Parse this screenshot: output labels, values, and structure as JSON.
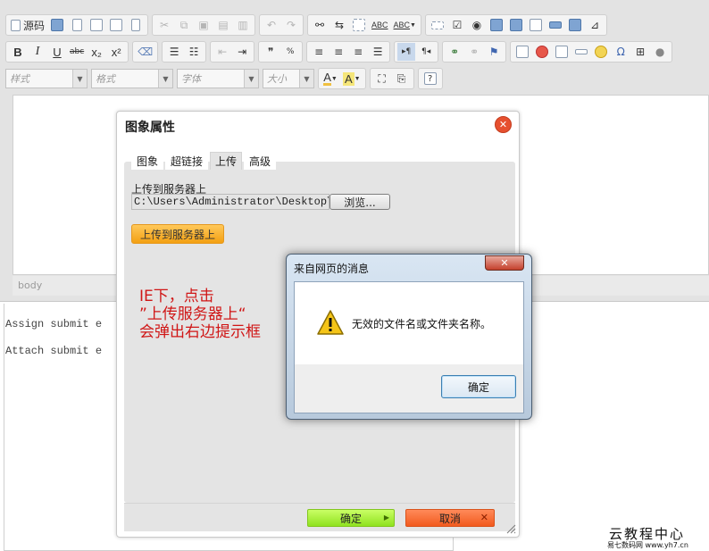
{
  "toolbar": {
    "source_label": "源码",
    "combos": [
      {
        "label": "样式"
      },
      {
        "label": "格式"
      },
      {
        "label": "字体"
      },
      {
        "label": "大小"
      }
    ],
    "subscript": "x₂",
    "superscript": "x²",
    "spellcheck": "ABC",
    "text_color_glyph": "A",
    "bg_color_glyph": "A",
    "help_glyph": "?"
  },
  "editor": {
    "status_path": "body"
  },
  "form": {
    "line1": "Assign submit  e",
    "line2": "Attach submit  e"
  },
  "image_dialog": {
    "title": "图象属性",
    "tabs": [
      {
        "label": "图象",
        "active": false
      },
      {
        "label": "超链接",
        "active": false
      },
      {
        "label": "上传",
        "active": true
      },
      {
        "label": "高级",
        "active": false
      }
    ],
    "upload_label": "上传到服务器上",
    "file_path": "C:\\Users\\Administrator\\Desktop\\东",
    "browse_label": "浏览...",
    "upload_button": "上传到服务器上",
    "ok_label": "确定",
    "cancel_label": "取消"
  },
  "annotation": {
    "lines": [
      "IE下，点击",
      "”上传服务器上“",
      "会弹出右边提示框"
    ]
  },
  "message_box": {
    "title": "来自网页的消息",
    "message": "无效的文件名或文件夹名称。",
    "ok_label": "确定"
  },
  "watermark": {
    "title": "云教程中心",
    "url": "易七数码网   www.yh7.cn"
  },
  "colors": {
    "upload_button": "#f7a824",
    "ok_button": "#a6ee3a",
    "cancel_button": "#f26a30",
    "annotation": "#d01616",
    "close_button": "#e6502f"
  }
}
